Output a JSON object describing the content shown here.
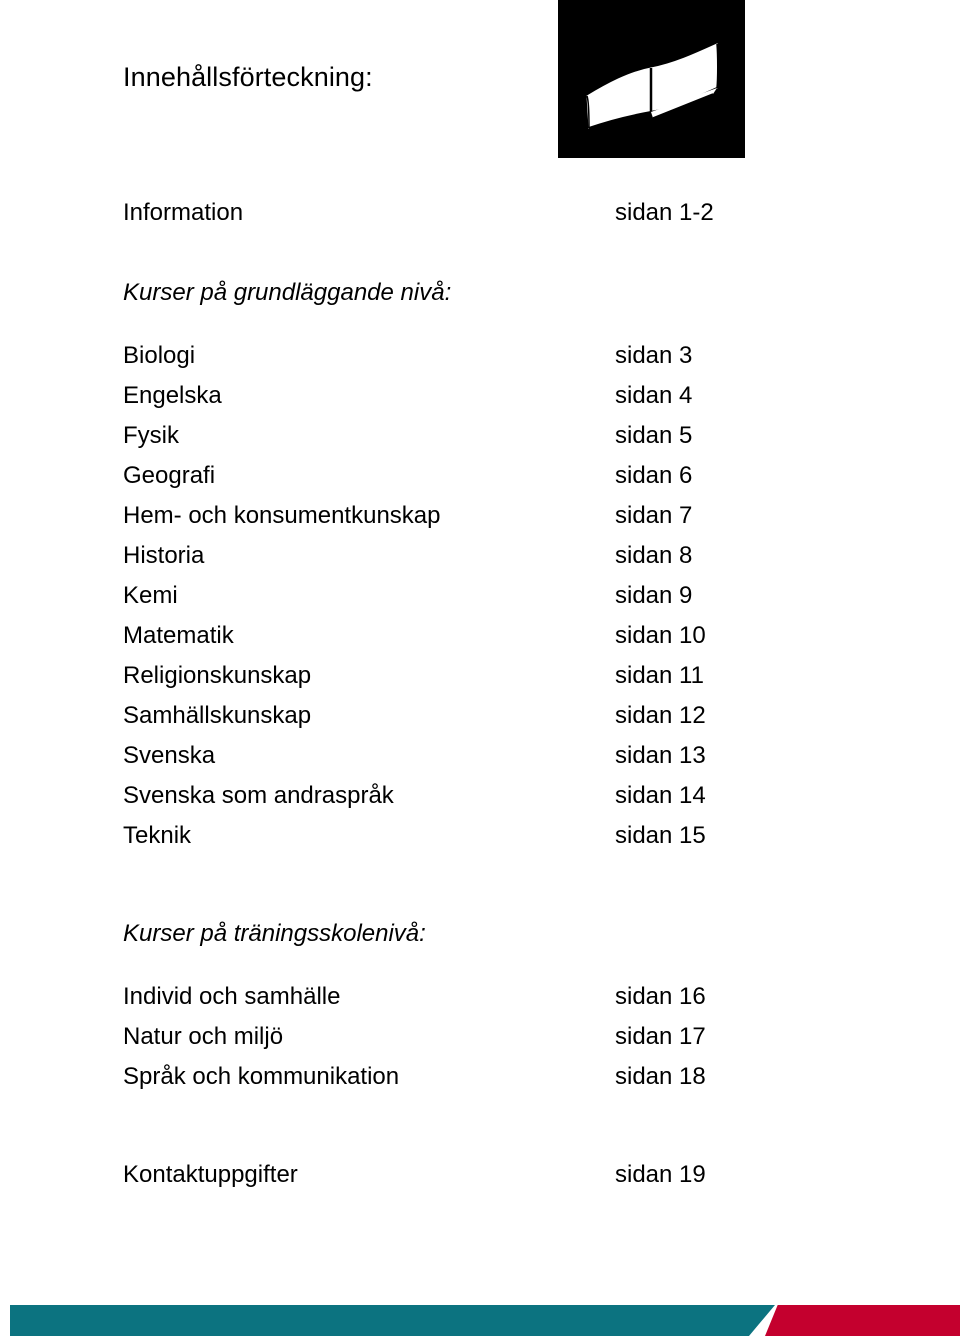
{
  "document": {
    "title": "Innehållsförteckning:",
    "header_icon": "open-book-icon"
  },
  "toc": {
    "intro": {
      "label": "Information",
      "page_ref": "sidan 1-2"
    },
    "sections": [
      {
        "heading": "Kurser på grundläggande nivå:",
        "entries": [
          {
            "label": "Biologi",
            "page_ref": "sidan 3"
          },
          {
            "label": "Engelska",
            "page_ref": "sidan 4"
          },
          {
            "label": "Fysik",
            "page_ref": "sidan 5"
          },
          {
            "label": "Geografi",
            "page_ref": "sidan 6"
          },
          {
            "label": "Hem- och konsumentkunskap",
            "page_ref": "sidan 7"
          },
          {
            "label": "Historia",
            "page_ref": "sidan 8"
          },
          {
            "label": "Kemi",
            "page_ref": "sidan 9"
          },
          {
            "label": "Matematik",
            "page_ref": "sidan 10"
          },
          {
            "label": "Religionskunskap",
            "page_ref": "sidan 11"
          },
          {
            "label": "Samhällskunskap",
            "page_ref": "sidan 12"
          },
          {
            "label": "Svenska",
            "page_ref": "sidan 13"
          },
          {
            "label": "Svenska som andraspråk",
            "page_ref": "sidan 14"
          },
          {
            "label": "Teknik",
            "page_ref": "sidan 15"
          }
        ]
      },
      {
        "heading": "Kurser på träningsskolenivå:",
        "entries": [
          {
            "label": "Individ och samhälle",
            "page_ref": "sidan 16"
          },
          {
            "label": "Natur och miljö",
            "page_ref": "sidan 17"
          },
          {
            "label": "Språk och kommunikation",
            "page_ref": "sidan 18"
          }
        ]
      }
    ],
    "contact": {
      "label": "Kontaktuppgifter",
      "page_ref": "sidan 19"
    }
  },
  "footer": {
    "teal_color": "#0C7380",
    "red_color": "#C4002E"
  }
}
